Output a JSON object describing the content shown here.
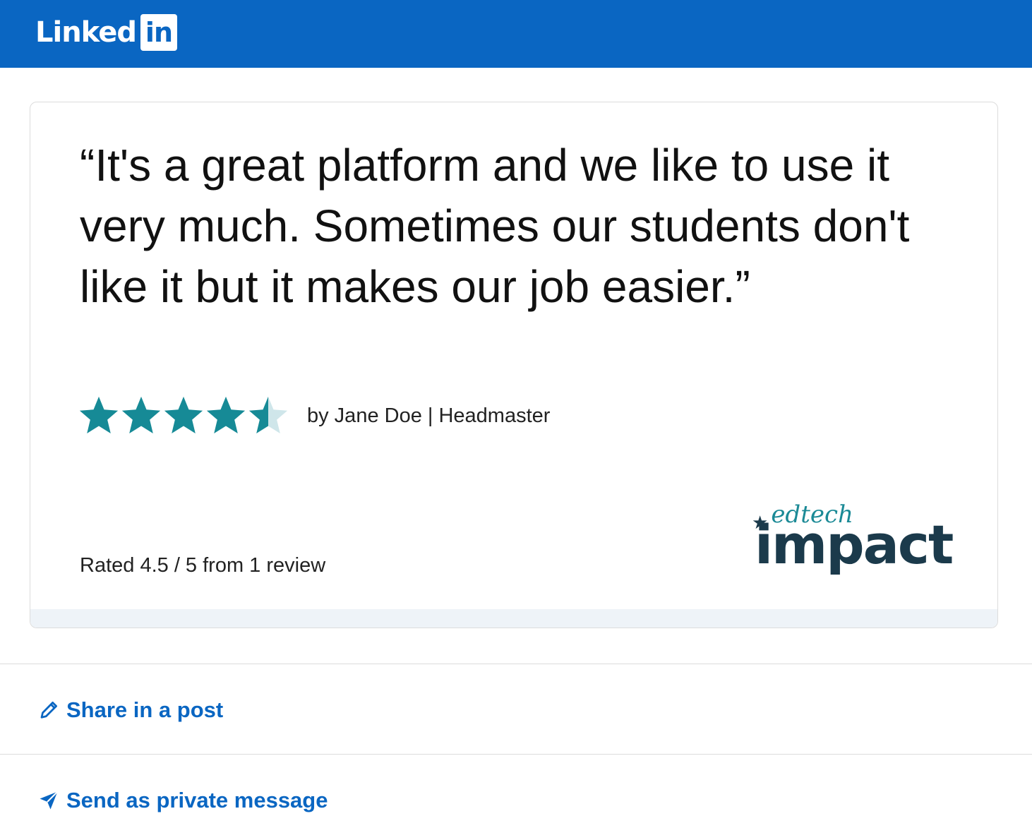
{
  "header": {
    "logo_word": "Linked",
    "logo_box": "in",
    "brand_color": "#0a66c2"
  },
  "review": {
    "quote": "“It's a great platform and we like to use it very much. Sometimes our students don't like it but it makes our job easier.”",
    "rating": 4.5,
    "rating_max": 5,
    "byline": "by Jane Doe | Headmaster",
    "rated_text": "Rated 4.5 / 5 from 1 review",
    "star_color": "#168a96",
    "star_empty_color": "#cfe6ea"
  },
  "brand": {
    "sub": "edtech",
    "main": "impact",
    "star_icon": "star-icon"
  },
  "actions": [
    {
      "label": "Share in a post",
      "icon": "pencil-icon"
    },
    {
      "label": "Send as private message",
      "icon": "paper-plane-icon"
    }
  ]
}
